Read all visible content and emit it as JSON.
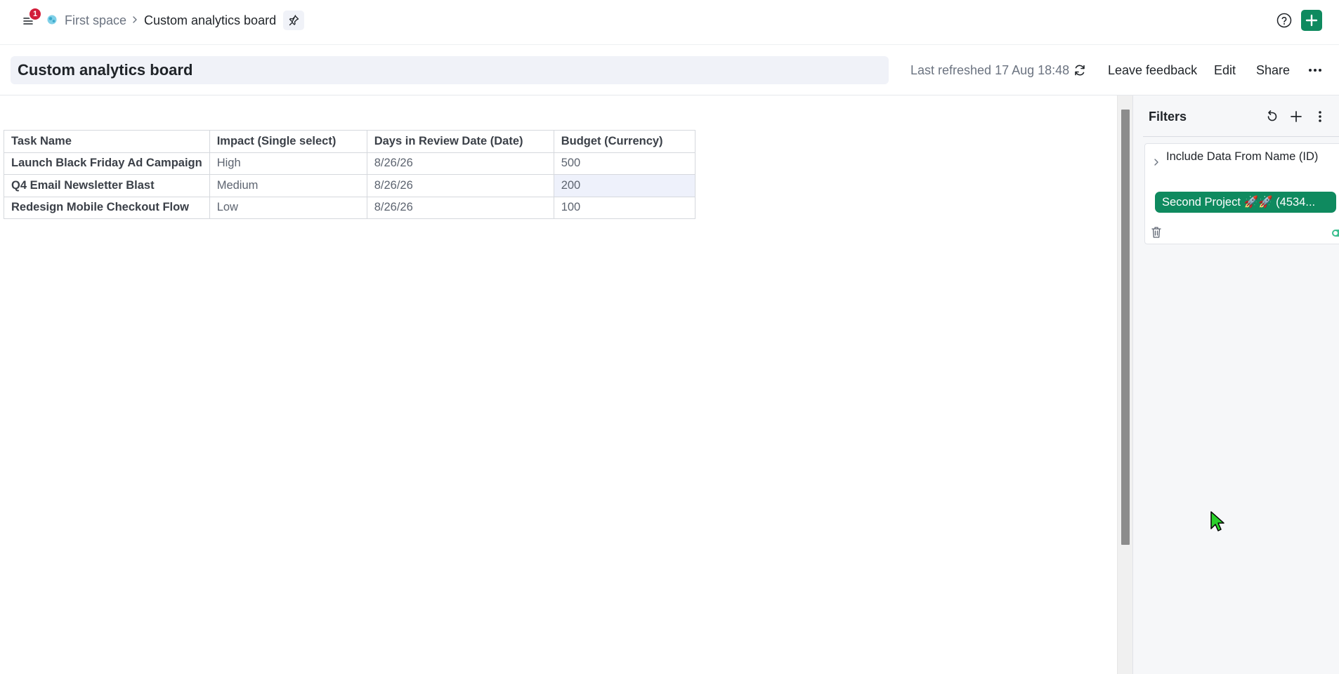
{
  "header": {
    "notification_count": "1",
    "breadcrumb_space": "First space",
    "breadcrumb_board": "Custom analytics board",
    "icons": {
      "menu": "hamburger-icon",
      "space": "globe-icon",
      "chevron": "chevron-right-icon",
      "pin": "pin-icon",
      "help": "help-circle-icon",
      "add": "plus-icon"
    },
    "accent_color": "#0f8a5f",
    "badge_color": "#d21d3a"
  },
  "toolbar": {
    "title": "Custom analytics board",
    "last_refreshed": "Last refreshed 17 Aug 18:48",
    "leave_feedback": "Leave feedback",
    "edit": "Edit",
    "share": "Share",
    "more": "···"
  },
  "table": {
    "columns": [
      "Task Name",
      "Impact (Single select)",
      "Days in Review Date (Date)",
      "Budget (Currency)"
    ],
    "rows": [
      [
        "Launch Black Friday Ad Campaign",
        "High",
        "8/26/26",
        "500"
      ],
      [
        "Q4 Email Newsletter Blast",
        "Medium",
        "8/26/26",
        "200"
      ],
      [
        "Redesign Mobile Checkout Flow",
        "Low",
        "8/26/26",
        "100"
      ]
    ]
  },
  "filters": {
    "title": "Filters",
    "items": [
      {
        "label": "Include Data From Name (ID)",
        "value": "Second Project 🚀🚀 (4534...",
        "enabled": true
      }
    ]
  }
}
